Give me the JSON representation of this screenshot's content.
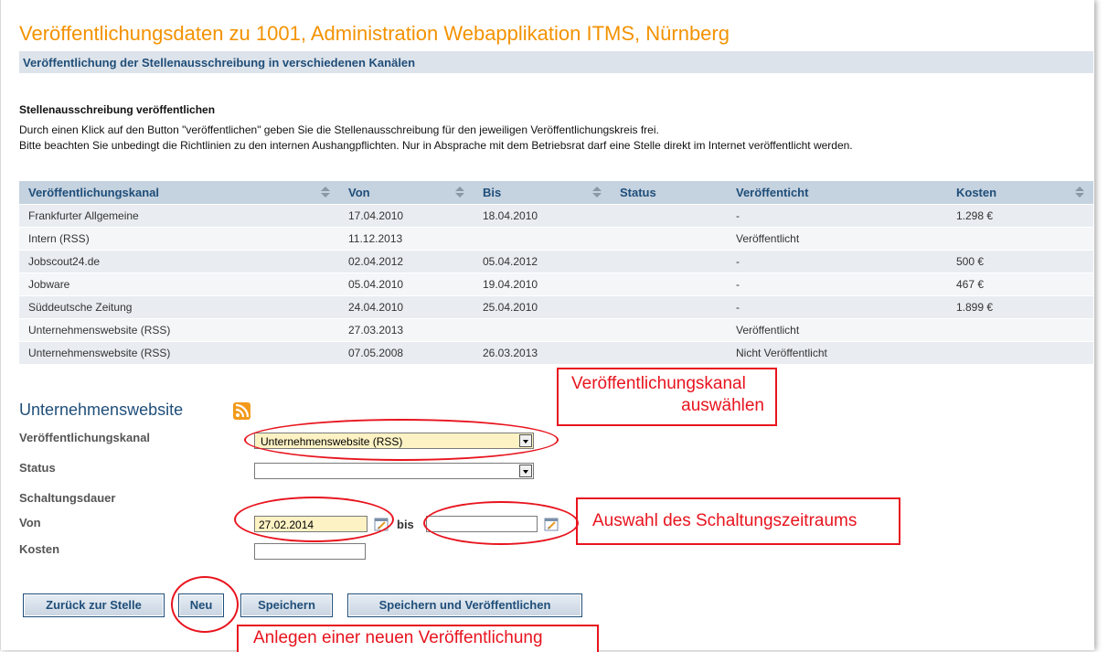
{
  "page": {
    "title": "Veröffentlichungsdaten zu 1001, Administration Webapplikation ITMS, Nürnberg",
    "subtitle": "Veröffentlichung der Stellenausschreibung in verschiedenen Kanälen"
  },
  "info": {
    "heading": "Stellenausschreibung veröffentlichen",
    "line1": "Durch einen Klick auf den Button \"veröffentlichen\" geben Sie die Stellenausschreibung für den jeweiligen Veröffentlichungskreis frei.",
    "line2": "Bitte beachten Sie unbedingt die Richtlinien zu den internen Aushangpflichten. Nur in Absprache mit dem Betriebsrat darf eine Stelle direkt im Internet veröffentlicht werden."
  },
  "table": {
    "headers": [
      "Veröffentlichungskanal",
      "Von",
      "Bis",
      "Status",
      "Veröffenticht",
      "Kosten"
    ],
    "rows": [
      [
        "Frankfurter Allgemeine",
        "17.04.2010",
        "18.04.2010",
        "",
        "-",
        "1.298 €"
      ],
      [
        "Intern (RSS)",
        "11.12.2013",
        "",
        "",
        "Veröffentlicht",
        ""
      ],
      [
        "Jobscout24.de",
        "02.04.2012",
        "05.04.2012",
        "",
        "-",
        "500 €"
      ],
      [
        "Jobware",
        "05.04.2010",
        "19.04.2010",
        "",
        "-",
        "467 €"
      ],
      [
        "Süddeutsche Zeitung",
        "24.04.2010",
        "25.04.2010",
        "",
        "-",
        "1.899 €"
      ],
      [
        "Unternehmenswebsite (RSS)",
        "27.03.2013",
        "",
        "",
        "Veröffentlicht",
        ""
      ],
      [
        "Unternehmenswebsite (RSS)",
        "07.05.2008",
        "26.03.2013",
        "",
        "Nicht Veröffentlicht",
        ""
      ]
    ]
  },
  "form": {
    "title": "Unternehmenswebsite",
    "icon": "rss-icon",
    "kanal_label": "Veröffentlichungskanal",
    "kanal_value": "Unternehmenswebsite (RSS)",
    "status_label": "Status",
    "status_value": "",
    "dauer_label": "Schaltungsdauer",
    "von_label": "Von",
    "von_value": "27.02.2014",
    "bis_label": "bis",
    "bis_value": "",
    "kosten_label": "Kosten",
    "kosten_value": ""
  },
  "buttons": {
    "back": "Zurück zur Stelle",
    "new": "Neu",
    "save": "Speichern",
    "save_publish": "Speichern und Veröffentlichen"
  },
  "annotations": {
    "kanal_line1": "Veröffentlichungskanal",
    "kanal_line2": "auswählen",
    "zeitraum": "Auswahl des Schaltungszeitraums",
    "neu": "Anlegen einer neuen Veröffentlichung"
  },
  "colors": {
    "title": "#f39200",
    "accent": "#1f4e79",
    "annotation": "#e8141e",
    "highlight_field": "#fdf2c4"
  }
}
